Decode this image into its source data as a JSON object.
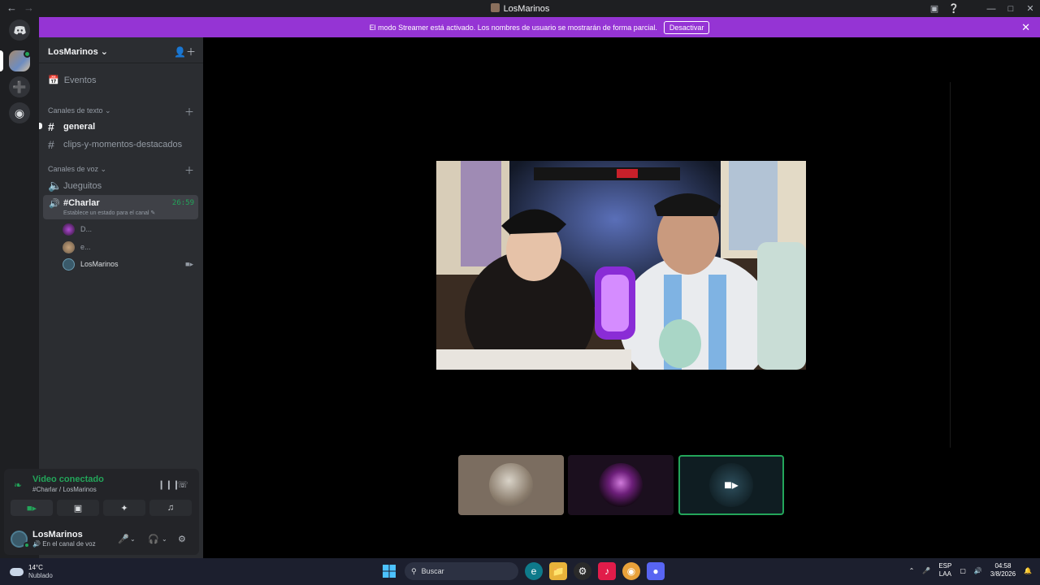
{
  "window": {
    "title": "LosMarinos"
  },
  "banner": {
    "text": "El modo Streamer está activado. Los nombres de usuario se mostrarán de forma parcial.",
    "button": "Desactivar"
  },
  "server": {
    "name": "LosMarinos",
    "events": "Eventos"
  },
  "text_channels": {
    "category": "Canales de texto",
    "items": [
      "general",
      "clips-y-momentos-destacados"
    ]
  },
  "voice_channels": {
    "category": "Canales de voz",
    "items": [
      "Jueguitos"
    ],
    "active": {
      "name": "#Charlar",
      "timer": "26:59",
      "status": "Establece un estado para el canal"
    }
  },
  "voice_users": [
    "D...",
    "e...",
    "LosMarinos"
  ],
  "voice_panel": {
    "status": "Video conectado",
    "channel": "#Charlar / LosMarinos",
    "user_name": "LosMarinos",
    "user_status": "En el canal de voz"
  },
  "taskbar": {
    "temp": "14°C",
    "weather": "Nublado",
    "search": "Buscar",
    "lang1": "ESP",
    "lang2": "LAA",
    "time": "04:58",
    "date": "3/8/2026"
  },
  "colors": {
    "banner": "#9534d4",
    "connected": "#23a55a",
    "sidebar": "#2b2d31",
    "rail": "#1e1f22"
  }
}
